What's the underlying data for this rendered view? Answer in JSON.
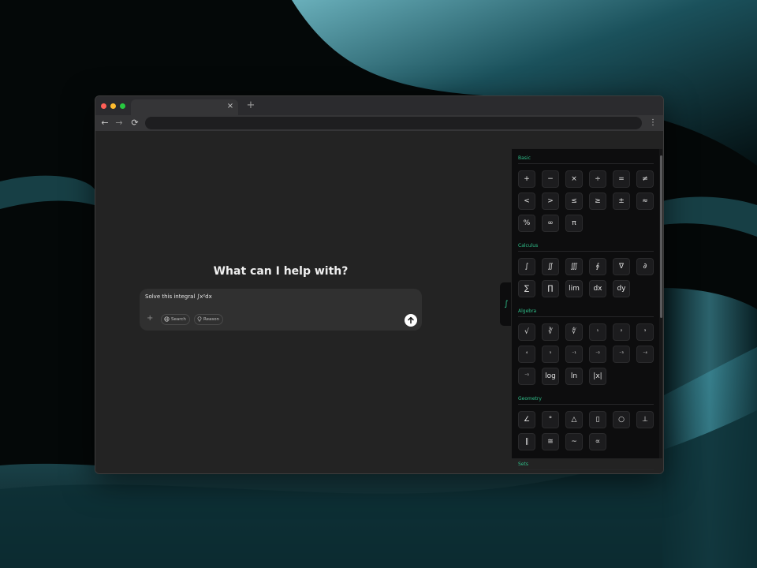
{
  "browser": {
    "tab_close": "×",
    "new_tab": "+",
    "nav": {
      "back": "←",
      "forward": "→",
      "reload": "⟳"
    },
    "menu": "⋮",
    "address": ""
  },
  "chat": {
    "heading": "What can I help with?",
    "input_value": "Solve this integral ∫x²dx",
    "attach": "+",
    "search_label": "Search",
    "reason_label": "Reason"
  },
  "panel": {
    "tab_symbol": "∫",
    "sections": [
      {
        "title": "Basic",
        "keys": [
          "+",
          "−",
          "×",
          "÷",
          "=",
          "≠",
          "<",
          ">",
          "≤",
          "≥",
          "±",
          "≈",
          "%",
          "∞",
          "π"
        ]
      },
      {
        "title": "Calculus",
        "keys": [
          "∫",
          "∬",
          "∭",
          "∮",
          "∇",
          "∂",
          "∑",
          "∏",
          "lim",
          "dx",
          "dy"
        ]
      },
      {
        "title": "Algebra",
        "keys": [
          "√",
          "∛",
          "∜",
          "¹",
          "²",
          "³",
          "⁴",
          "⁵",
          "⁻¹",
          "⁻²",
          "⁻³",
          "⁻⁴",
          "⁻⁵",
          "log",
          "ln",
          "|x|"
        ]
      },
      {
        "title": "Geometry",
        "keys": [
          "∠",
          "°",
          "△",
          "▯",
          "○",
          "⊥",
          "∥",
          "≅",
          "~",
          "∝"
        ]
      },
      {
        "title": "Sets",
        "keys": []
      }
    ]
  },
  "colors": {
    "accent": "#2fbf8a",
    "page_bg": "#232323",
    "composer_bg": "#303030",
    "panel_bg": "#0d0d0e",
    "window_dots": [
      "#ff5f57",
      "#febc2e",
      "#28c840"
    ]
  }
}
